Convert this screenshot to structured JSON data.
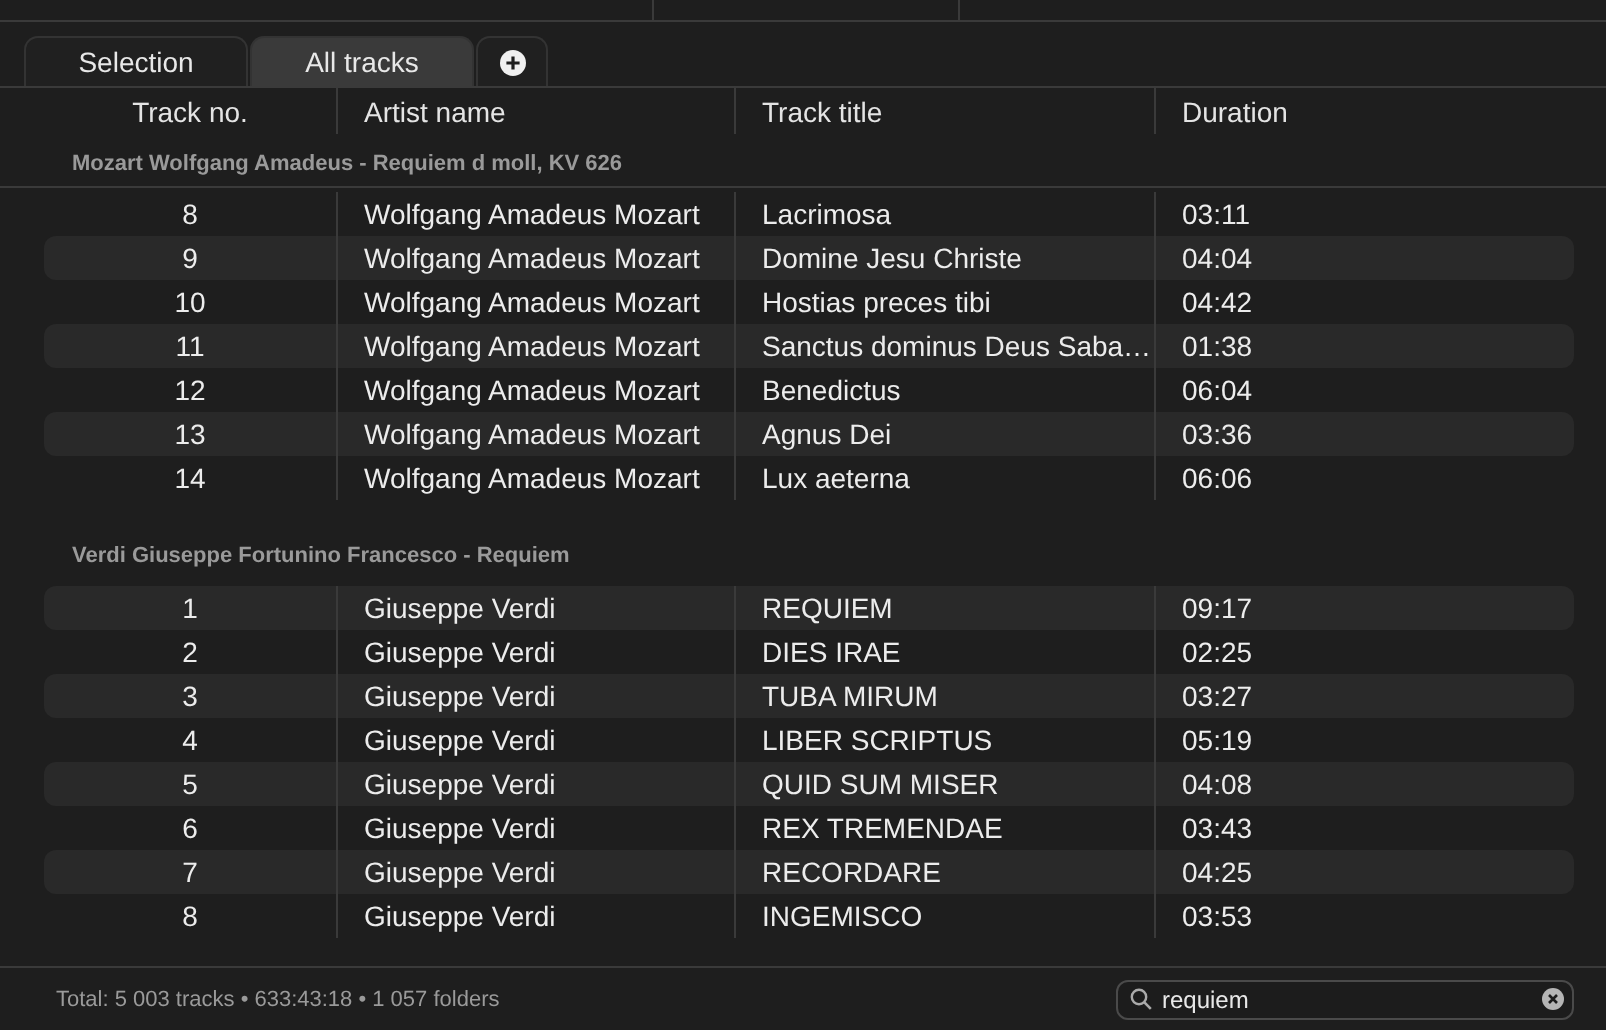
{
  "tabs": [
    {
      "label": "Selection",
      "selected": false
    },
    {
      "label": "All tracks",
      "selected": true
    }
  ],
  "columns": [
    "Track no.",
    "Artist name",
    "Track title",
    "Duration"
  ],
  "groups": [
    {
      "title": "Mozart Wolfgang Amadeus - Requiem d moll, KV 626",
      "rows": [
        {
          "no": "8",
          "artist": "Wolfgang Amadeus Mozart",
          "title": "Lacrimosa",
          "duration": "03:11"
        },
        {
          "no": "9",
          "artist": "Wolfgang Amadeus Mozart",
          "title": "Domine Jesu Christe",
          "duration": "04:04"
        },
        {
          "no": "10",
          "artist": "Wolfgang Amadeus Mozart",
          "title": "Hostias preces tibi",
          "duration": "04:42"
        },
        {
          "no": "11",
          "artist": "Wolfgang Amadeus Mozart",
          "title": "Sanctus dominus Deus Saba…",
          "duration": "01:38"
        },
        {
          "no": "12",
          "artist": "Wolfgang Amadeus Mozart",
          "title": "Benedictus",
          "duration": "06:04"
        },
        {
          "no": "13",
          "artist": "Wolfgang Amadeus Mozart",
          "title": "Agnus Dei",
          "duration": "03:36"
        },
        {
          "no": "14",
          "artist": "Wolfgang Amadeus Mozart",
          "title": "Lux aeterna",
          "duration": "06:06"
        }
      ]
    },
    {
      "title": "Verdi Giuseppe Fortunino Francesco - Requiem",
      "rows": [
        {
          "no": "1",
          "artist": "Giuseppe Verdi",
          "title": "REQUIEM",
          "duration": "09:17"
        },
        {
          "no": "2",
          "artist": "Giuseppe Verdi",
          "title": "DIES IRAE",
          "duration": "02:25"
        },
        {
          "no": "3",
          "artist": "Giuseppe Verdi",
          "title": "TUBA MIRUM",
          "duration": "03:27"
        },
        {
          "no": "4",
          "artist": "Giuseppe Verdi",
          "title": "LIBER SCRIPTUS",
          "duration": "05:19"
        },
        {
          "no": "5",
          "artist": "Giuseppe Verdi",
          "title": "QUID SUM MISER",
          "duration": "04:08"
        },
        {
          "no": "6",
          "artist": "Giuseppe Verdi",
          "title": "REX TREMENDAE",
          "duration": "03:43"
        },
        {
          "no": "7",
          "artist": "Giuseppe Verdi",
          "title": "RECORDARE",
          "duration": "04:25"
        },
        {
          "no": "8",
          "artist": "Giuseppe Verdi",
          "title": "INGEMISCO",
          "duration": "03:53"
        }
      ]
    }
  ],
  "status": "Total: 5 003 tracks • 633:43:18 • 1 057 folders",
  "search": {
    "value": "requiem"
  }
}
